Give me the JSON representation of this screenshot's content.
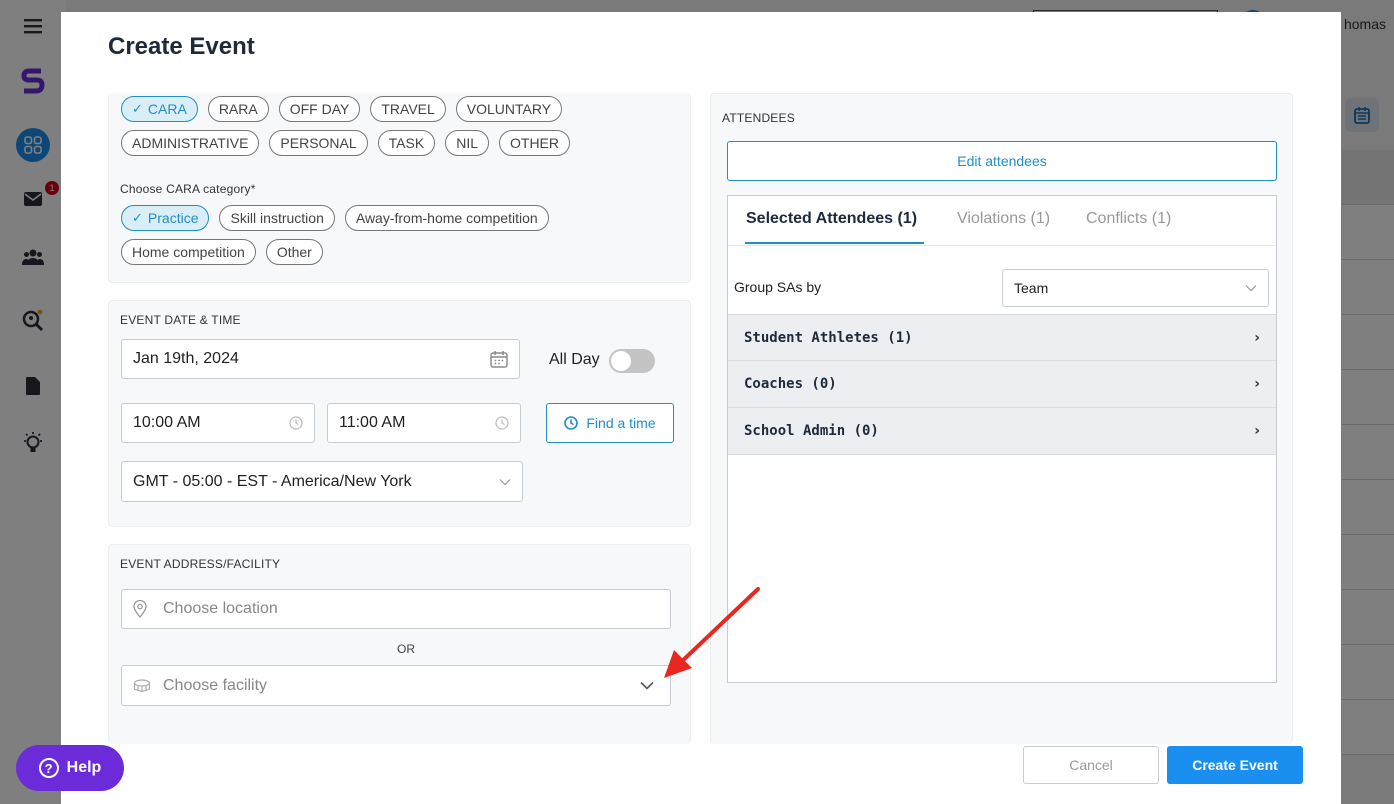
{
  "background": {
    "user_name": "homas",
    "mail_badge": "1"
  },
  "help": {
    "label": "Help"
  },
  "modal": {
    "title": "Create Event",
    "event_types": {
      "row1": [
        "CARA",
        "RARA",
        "OFF DAY",
        "TRAVEL",
        "VOLUNTARY"
      ],
      "row2": [
        "ADMINISTRATIVE",
        "PERSONAL",
        "TASK",
        "NIL",
        "OTHER"
      ],
      "selected": "CARA"
    },
    "category": {
      "label": "Choose CARA category*",
      "row1": [
        "Practice",
        "Skill instruction",
        "Away-from-home competition"
      ],
      "row2": [
        "Home competition",
        "Other"
      ],
      "selected": "Practice"
    },
    "datetime": {
      "section_label": "EVENT DATE & TIME",
      "date": "Jan 19th, 2024",
      "all_day_label": "All Day",
      "all_day": false,
      "start_time": "10:00 AM",
      "end_time": "11:00 AM",
      "find_time_label": "Find a time",
      "timezone": "GMT - 05:00 - EST - America/New York"
    },
    "address": {
      "section_label": "EVENT ADDRESS/FACILITY",
      "location_placeholder": "Choose location",
      "or_label": "OR",
      "facility_placeholder": "Choose facility"
    },
    "attendees": {
      "section_label": "ATTENDEES",
      "edit_label": "Edit attendees",
      "tabs": [
        "Selected Attendees (1)",
        "Violations (1)",
        "Conflicts (1)"
      ],
      "active_tab": "Selected Attendees (1)",
      "group_by_label": "Group SAs by",
      "group_by_value": "Team",
      "groups": [
        "Student Athletes (1)",
        "Coaches (0)",
        "School Admin (0)"
      ]
    },
    "footer": {
      "cancel_label": "Cancel",
      "create_label": "Create Event"
    }
  },
  "colors": {
    "accent": "#1f8ec9",
    "primary_button": "#1a8ff0",
    "help_button": "#6c2bd9",
    "annotation_arrow": "#e8281e"
  }
}
